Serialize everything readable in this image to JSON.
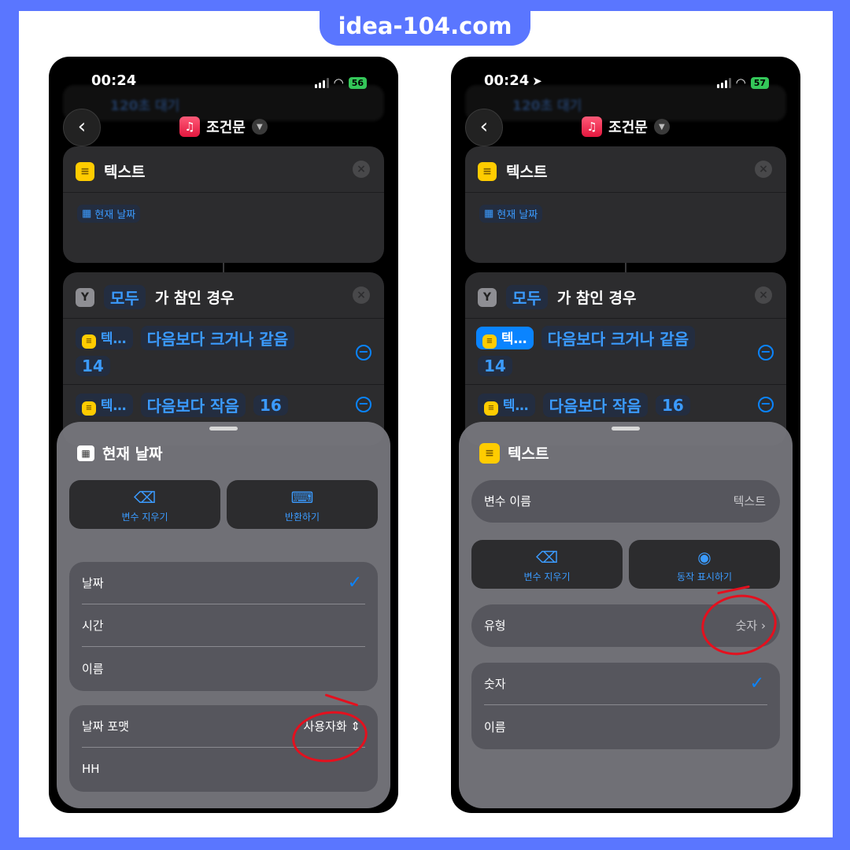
{
  "site": {
    "watermark": "idea-104.com"
  },
  "colors": {
    "accent_blue": "#0a84ff",
    "annotation_red": "#e4101e",
    "border_blue": "#5a76ff"
  },
  "left": {
    "status": {
      "time": "00:24",
      "battery": "56"
    },
    "ghost_bar": {
      "text": "120초 대기"
    },
    "nav": {
      "title": "조건문",
      "back_icon": "chevron-left-icon"
    },
    "text_card": {
      "title": "텍스트",
      "token": "현재 날짜"
    },
    "if_card": {
      "token_all": "모두",
      "title_rest": "가 참인 경우",
      "cond1": {
        "var": "텍…",
        "op": "다음보다 크거나 같음",
        "value": "14"
      },
      "cond2": {
        "var": "텍…",
        "op": "다음보다 작음",
        "value": "16"
      }
    },
    "sheet": {
      "title": "현재 날짜",
      "btn_clear": "변수 지우기",
      "btn_convert": "반환하기",
      "options": [
        "날짜",
        "시간",
        "이름"
      ],
      "format_label": "날짜 포맷",
      "format_value": "사용자화",
      "format_string": "HH"
    }
  },
  "right": {
    "status": {
      "time": "00:24",
      "battery": "57"
    },
    "ghost_bar": {
      "text": "120초 대기"
    },
    "nav": {
      "title": "조건문",
      "back_icon": "chevron-left-icon"
    },
    "text_card": {
      "title": "텍스트",
      "token": "현재 날짜"
    },
    "if_card": {
      "token_all": "모두",
      "title_rest": "가 참인 경우",
      "cond1": {
        "var": "텍…",
        "op": "다음보다 크거나 같음",
        "value": "14"
      },
      "cond2": {
        "var": "텍…",
        "op": "다음보다 작음",
        "value": "16"
      }
    },
    "sheet": {
      "title": "텍스트",
      "var_name_label": "변수 이름",
      "var_name_value": "텍스트",
      "btn_clear": "변수 지우기",
      "btn_show": "동작 표시하기",
      "type_label": "유형",
      "type_value": "숫자",
      "options": [
        "숫자",
        "이름"
      ]
    }
  }
}
